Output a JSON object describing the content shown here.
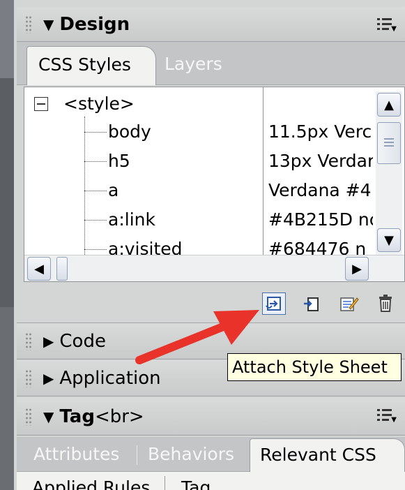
{
  "design_panel": {
    "title": "Design",
    "tabs": [
      "CSS Styles",
      "Layers"
    ],
    "css_root": "<style>",
    "rules": [
      {
        "name": "body",
        "value": "11.5px Verc"
      },
      {
        "name": "h5",
        "value": "13px Verdar"
      },
      {
        "name": "a",
        "value": "Verdana #4"
      },
      {
        "name": "a:link",
        "value": "#4B215D nc"
      },
      {
        "name": "a:visited",
        "value": "#684476 n"
      }
    ]
  },
  "toolbar": {
    "buttons": [
      "attach-style-sheet",
      "new-css-rule",
      "edit-style",
      "delete-css-rule"
    ]
  },
  "tooltip": "Attach Style Sheet",
  "code_panel": {
    "title": "Code"
  },
  "application_panel": {
    "title": "Application"
  },
  "tag_panel": {
    "title_prefix": "Tag ",
    "title_tag": "<br>",
    "tabs": [
      "Attributes",
      "Behaviors",
      "Relevant CSS"
    ],
    "subtabs": [
      "Applied Rules",
      "Tag"
    ]
  },
  "colors": {
    "annotation_arrow": "#e8322a",
    "tooltip_bg": "#ffffe1"
  }
}
